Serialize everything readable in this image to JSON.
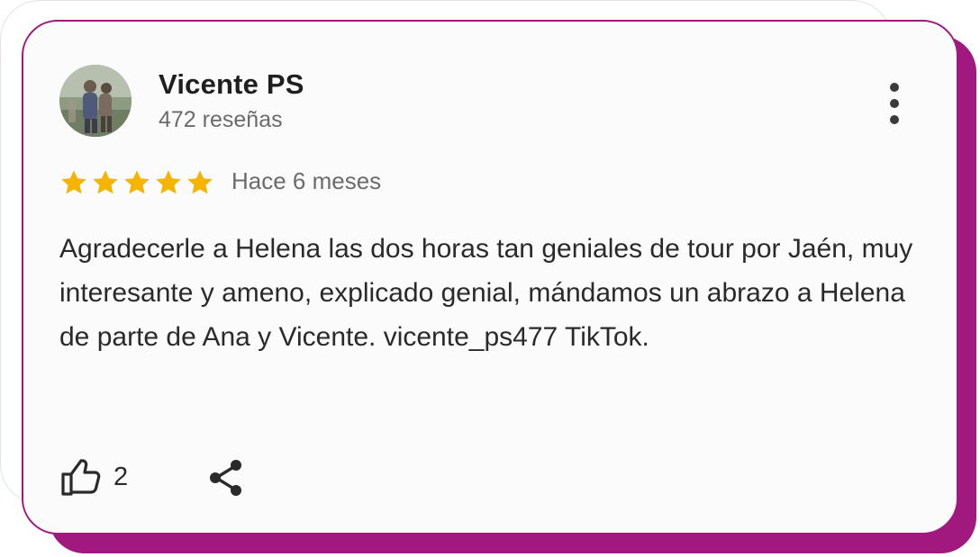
{
  "review": {
    "author_name": "Vicente PS",
    "author_reviews": "472 reseñas",
    "rating": 5,
    "rating_max": 5,
    "time_ago": "Hace 6 meses",
    "text": "Agradecerle a Helena las dos horas tan geniales de tour por Jaén, muy interesante y ameno, explicado genial, mándamos un abrazo a Helena de parte de Ana y Vicente. vicente_ps477 TikTok.",
    "like_count": "2"
  },
  "icons": {
    "more": "more-vertical-icon",
    "like": "thumbs-up-icon",
    "share": "share-icon",
    "star": "star-icon"
  },
  "colors": {
    "accent": "#a1197f",
    "star": "#f4b400",
    "text": "#2a2a2a",
    "muted": "#6b6b6b"
  }
}
